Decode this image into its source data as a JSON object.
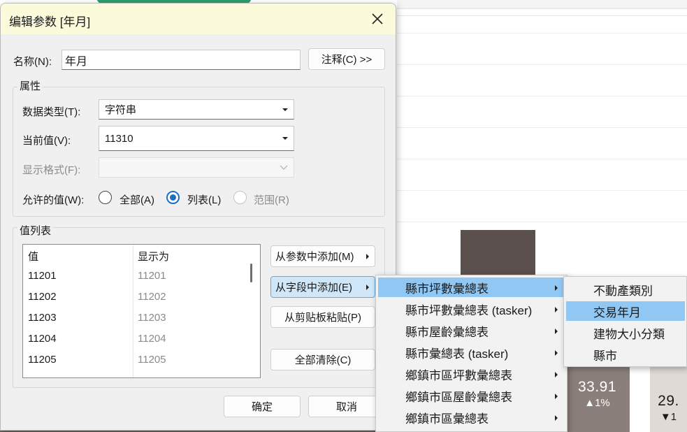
{
  "dialog": {
    "title": "编辑参数 [年月]",
    "name_label": "名称(N):",
    "name_value": "年月",
    "comment_button": "注释(C) >>",
    "properties_group": "属性",
    "data_type_label": "数据类型(T):",
    "data_type_value": "字符串",
    "current_value_label": "当前值(V):",
    "current_value": "11310",
    "display_format_label": "显示格式(F):",
    "display_format_value": "",
    "allowed_values_label": "允许的值(W):",
    "allowed_options": [
      {
        "label": "全部(A)",
        "checked": false,
        "disabled": false
      },
      {
        "label": "列表(L)",
        "checked": true,
        "disabled": false
      },
      {
        "label": "范围(R)",
        "checked": false,
        "disabled": true
      }
    ],
    "value_list_group": "值列表",
    "list_headers": [
      "值",
      "显示为"
    ],
    "list_rows": [
      [
        "11201",
        "11201"
      ],
      [
        "11202",
        "11202"
      ],
      [
        "11203",
        "11203"
      ],
      [
        "11204",
        "11204"
      ],
      [
        "11205",
        "11205"
      ]
    ],
    "add_from_parameter": "从参数中添加(M)",
    "add_from_field": "从字段中添加(E)",
    "paste_from_clipboard": "从剪贴板粘贴(P)",
    "clear_all": "全部清除(C)",
    "ok_button": "确定",
    "cancel_button": "取消"
  },
  "field_menu": {
    "items": [
      {
        "label": "縣市坪數彙總表",
        "highlighted": true
      },
      {
        "label": "縣市坪數彙總表 (tasker)",
        "highlighted": false
      },
      {
        "label": "縣市屋齡彙總表",
        "highlighted": false
      },
      {
        "label": "縣市彙總表 (tasker)",
        "highlighted": false
      },
      {
        "label": "鄉鎮市區坪數彙總表",
        "highlighted": false
      },
      {
        "label": "鄉鎮市區屋齡彙總表",
        "highlighted": false
      },
      {
        "label": "鄉鎮市區彙總表",
        "highlighted": false
      }
    ]
  },
  "field_submenu": {
    "items": [
      {
        "label": "不動產類別",
        "highlighted": false
      },
      {
        "label": "交易年月",
        "highlighted": true
      },
      {
        "label": "建物大小分類",
        "highlighted": false
      },
      {
        "label": "縣市",
        "highlighted": false
      }
    ]
  },
  "background": {
    "tile1_value": "33.91",
    "tile1_change": "▲1%",
    "tile2_value": "29.",
    "tile2_change": "▼1"
  },
  "colors": {
    "dialog_bg": "#f0f0f0",
    "titlebar_bg": "#fbfbdc",
    "menu_highlight": "#91c7f3",
    "radio_accent": "#1c6fc1",
    "tile_dark": "#5b504d",
    "tile_mid": "#8a7f7a",
    "tile_light": "#e0dad6"
  }
}
